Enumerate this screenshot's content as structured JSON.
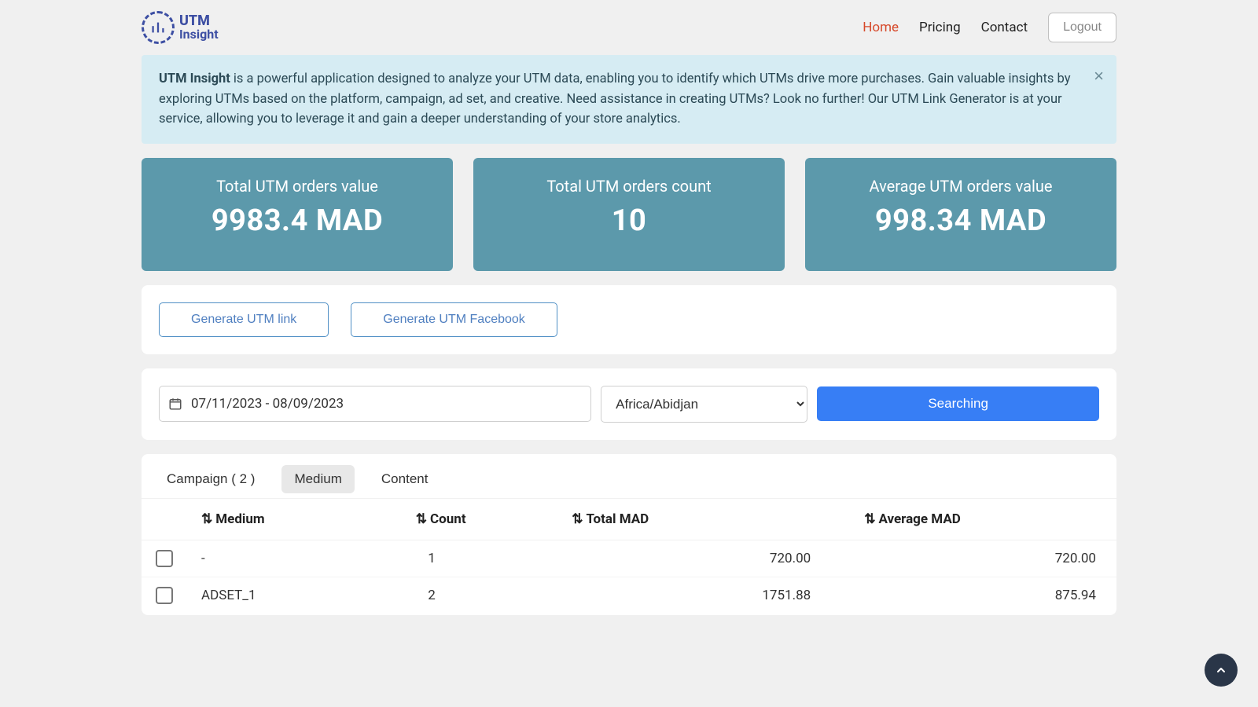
{
  "brand": {
    "line1": "UTM",
    "line2": "Insight"
  },
  "nav": {
    "home": "Home",
    "pricing": "Pricing",
    "contact": "Contact",
    "logout": "Logout"
  },
  "banner": {
    "strong": "UTM Insight",
    "text": " is a powerful application designed to analyze your UTM data, enabling you to identify which UTMs drive more purchases. Gain valuable insights by exploring UTMs based on the platform, campaign, ad set, and creative. Need assistance in creating UTMs? Look no further! Our UTM Link Generator is at your service, allowing you to leverage it and gain a deeper understanding of your store analytics."
  },
  "stats": {
    "total_value_label": "Total UTM orders value",
    "total_value": "9983.4 MAD",
    "total_count_label": "Total UTM orders count",
    "total_count": "10",
    "avg_value_label": "Average UTM orders value",
    "avg_value": "998.34 MAD"
  },
  "generate": {
    "link": "Generate UTM link",
    "facebook": "Generate UTM Facebook"
  },
  "search": {
    "date_range": "07/11/2023 - 08/09/2023",
    "timezone": "Africa/Abidjan",
    "button": "Searching"
  },
  "tabs": {
    "campaign": "Campaign ( 2 )",
    "medium": "Medium",
    "content": "Content"
  },
  "table": {
    "headers": {
      "medium": "Medium",
      "count": "Count",
      "total": "Total MAD",
      "avg": "Average MAD"
    },
    "rows": [
      {
        "medium": "-",
        "count": "1",
        "total": "720.00",
        "avg": "720.00"
      },
      {
        "medium": "ADSET_1",
        "count": "2",
        "total": "1751.88",
        "avg": "875.94"
      }
    ]
  }
}
